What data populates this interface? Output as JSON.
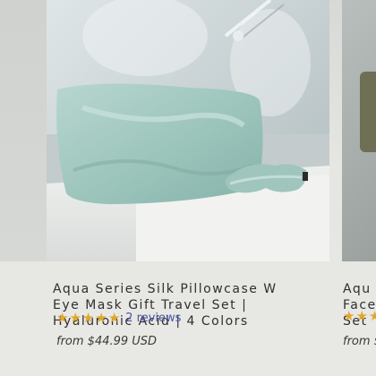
{
  "product": {
    "title_lines": [
      "Aqua Series Silk Pillowcase W",
      "Eye Mask Gift Travel Set |",
      "Hyaluronic Acid | 4 Colors"
    ],
    "rating_stars": 5,
    "reviews": "2 reviews",
    "price": "from $44.99 USD"
  },
  "next_product": {
    "title_lines": [
      "Aqu",
      "Face",
      "Set"
    ],
    "price": "from $"
  },
  "colors": {
    "star": "#e0a72b",
    "reviews_link": "#4a56a6",
    "silk": "#a7c9c2"
  },
  "icons": [
    "star-icon"
  ]
}
